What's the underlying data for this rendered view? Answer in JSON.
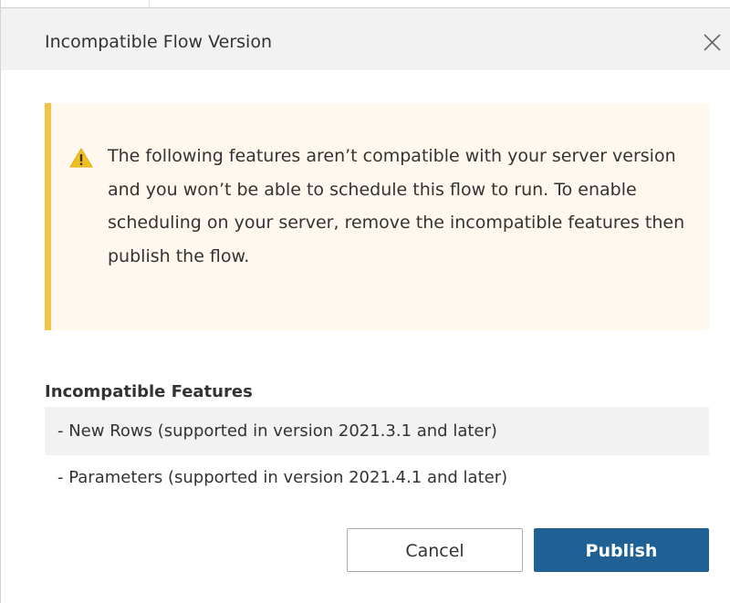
{
  "dialog": {
    "title": "Incompatible Flow Version",
    "close_icon": "close-icon"
  },
  "warning": {
    "icon": "warning-icon",
    "message": "The following features aren’t compatible with your server version and you won’t be able to schedule this flow to run. To enable scheduling on your server, remove the incompatible features then publish the flow.",
    "accent_color": "#f5c344",
    "background_color": "#fef8ee"
  },
  "features": {
    "heading": "Incompatible Features",
    "items": [
      "- New Rows (supported in version 2021.3.1 and later)",
      "- Parameters (supported in version 2021.4.1 and later)"
    ]
  },
  "actions": {
    "cancel_label": "Cancel",
    "publish_label": "Publish",
    "primary_color": "#1f6194"
  }
}
